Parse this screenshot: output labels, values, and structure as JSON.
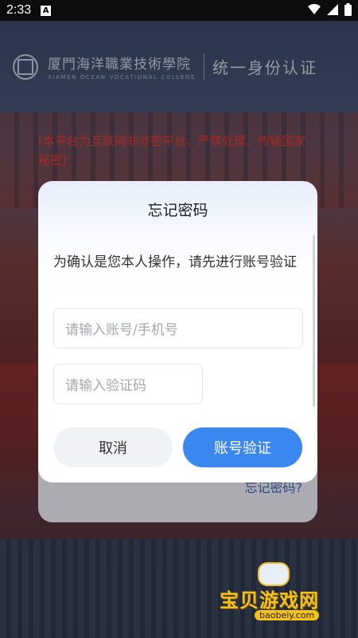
{
  "status_bar": {
    "time": "2:33",
    "notification_icon": "A"
  },
  "header": {
    "school_name_cn": "厦門海洋職業技術學院",
    "school_name_en": "XIAMEN OCEAN VOCATIONAL COLLEGE",
    "system_title": "统一身份认证"
  },
  "warning": "[本平台为互联网非涉密平台，严禁处理、传输国家秘密]",
  "background": {
    "forgot_link": "忘记密码?"
  },
  "dialog": {
    "title": "忘记密码",
    "message": "为确认是您本人操作，请先进行账号验证",
    "account_placeholder": "请输入账号/手机号",
    "code_placeholder": "请输入验证码",
    "cancel_label": "取消",
    "verify_label": "账号验证"
  },
  "watermark": {
    "name": "宝贝游戏网",
    "url": "baobeiy.com"
  },
  "colors": {
    "primary": "#3b87f0",
    "warning": "#e23b2f",
    "cancel_bg": "#f1f2f5"
  }
}
